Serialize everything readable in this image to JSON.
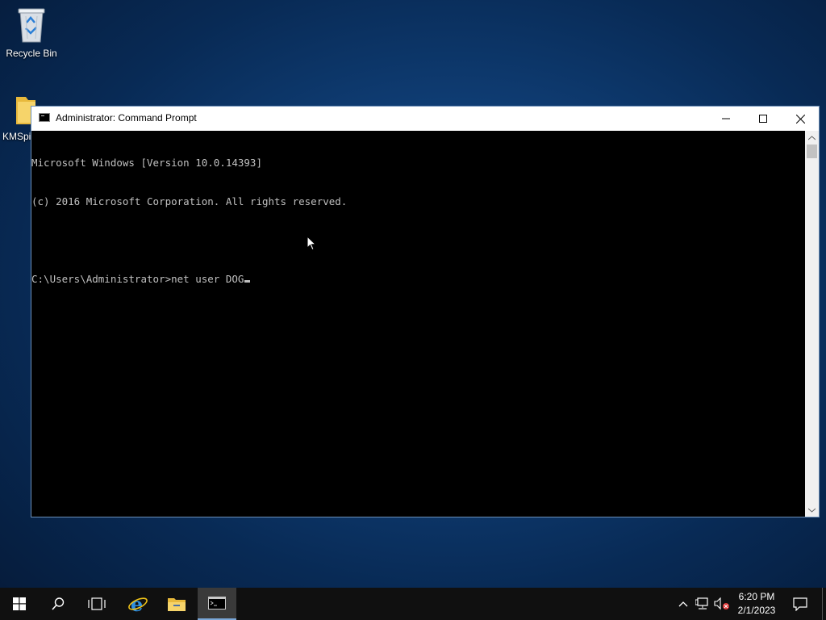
{
  "desktop": {
    "icons": [
      {
        "label": "Recycle Bin",
        "icon": "recycle-bin-icon"
      },
      {
        "label": "KMSpi",
        "icon": "folder-icon"
      }
    ]
  },
  "window": {
    "title": "Administrator: Command Prompt",
    "controls": {
      "minimize": "minimize-icon",
      "maximize": "maximize-icon",
      "close": "close-icon"
    },
    "console_lines": [
      "Microsoft Windows [Version 10.0.14393]",
      "(c) 2016 Microsoft Corporation. All rights reserved.",
      "",
      "C:\\Users\\Administrator>net user DOG"
    ]
  },
  "taskbar": {
    "buttons": [
      "windows-start-icon",
      "search-icon",
      "task-view-icon",
      "internet-explorer-icon",
      "file-explorer-icon",
      "command-prompt-icon"
    ],
    "active_app": "command-prompt",
    "tray": {
      "icons": [
        "chevron-up-icon",
        "network-icon",
        "volume-muted-icon",
        "notifications-icon"
      ]
    },
    "clock": {
      "time": "6:20 PM",
      "date": "2/1/2023"
    }
  },
  "colors": {
    "desktop_blue": "#0f3d74",
    "console_bg": "#000000",
    "console_fg": "#c0c0c0",
    "taskbar_bg": "#101010",
    "accent": "#7aa7d8"
  }
}
